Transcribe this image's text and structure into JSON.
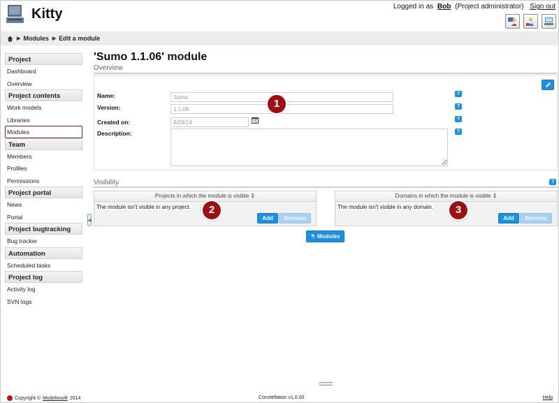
{
  "app": {
    "title": "Kitty"
  },
  "header": {
    "logged_in_prefix": "Logged in as",
    "user": "Bob",
    "role": "(Project administrator)",
    "sign_out": "Sign out",
    "role_buttons": [
      "person-icon",
      "person-icon",
      "person-icon"
    ]
  },
  "breadcrumb": {
    "home_icon": "home-icon",
    "items": [
      "Modules",
      "Edit a module"
    ]
  },
  "sidebar": {
    "sections": [
      {
        "title": "Project",
        "items": [
          "Dashboard",
          "Overview"
        ]
      },
      {
        "title": "Project contents",
        "items": [
          "Work models",
          "Libraries",
          "Modules"
        ]
      },
      {
        "title": "Team",
        "items": [
          "Members",
          "Profiles",
          "Permissions"
        ]
      },
      {
        "title": "Project portal",
        "items": [
          "News",
          "Portal"
        ]
      },
      {
        "title": "Project bugtracking",
        "items": [
          "Bug tracker"
        ]
      },
      {
        "title": "Automation",
        "items": [
          "Scheduled tasks"
        ]
      },
      {
        "title": "Project log",
        "items": [
          "Activity log",
          "SVN logs"
        ]
      }
    ],
    "active_item": "Modules"
  },
  "main": {
    "title": "'Sumo 1.1.06' module",
    "overview_label": "Overview",
    "fields": {
      "name_label": "Name:",
      "name_value": "Sumo",
      "version_label": "Version:",
      "version_value": "1.1.06",
      "created_label": "Created on:",
      "created_value": "9/29/14",
      "description_label": "Description:",
      "description_value": ""
    },
    "help_glyph": "?",
    "visibility_label": "Visibility",
    "projects_panel": {
      "header": "Projects in which the module is visible",
      "empty_text": "The module isn't visible in any project.",
      "add": "Add",
      "remove": "Remove"
    },
    "domains_panel": {
      "header": "Domains in which the module is visible",
      "empty_text": "The module isn't visible in any domain.",
      "add": "Add",
      "remove": "Remove"
    },
    "back_button": "Modules",
    "callouts": [
      "1",
      "2",
      "3"
    ]
  },
  "footer": {
    "copyright_prefix": "Copyright ©",
    "copyright_link": "Modeliosoft",
    "copyright_year": "2014",
    "version": "Constellation v1.0.00",
    "help": "Help"
  },
  "colors": {
    "accent": "#1d8fe0",
    "callout": "#9c0f14",
    "active_border": "#9a1b1b"
  }
}
